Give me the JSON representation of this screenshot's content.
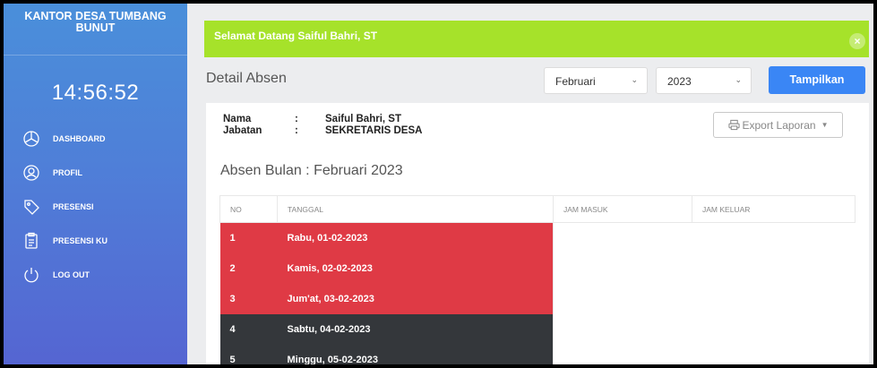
{
  "sidebar": {
    "brand": "KANTOR DESA TUMBANG BUNUT",
    "clock": "14:56:52",
    "items": [
      {
        "label": "DASHBOARD",
        "icon": "dashboard-icon"
      },
      {
        "label": "PROFIL",
        "icon": "profile-icon"
      },
      {
        "label": "PRESENSI",
        "icon": "tag-icon"
      },
      {
        "label": "PRESENSI KU",
        "icon": "clipboard-icon"
      },
      {
        "label": "LOG OUT",
        "icon": "power-icon"
      }
    ]
  },
  "alert": {
    "message": "Selamat Datang Saiful Bahri, ST",
    "close": "×"
  },
  "header": {
    "title": "Detail Absen",
    "month_value": "Februari",
    "year_value": "2023",
    "show_button": "Tampilkan"
  },
  "employee": {
    "name_label": "Nama",
    "name_value": "Saiful Bahri, ST",
    "position_label": "Jabatan",
    "position_value": "SEKRETARIS DESA",
    "separator": ":"
  },
  "export_button": "Export Laporan",
  "month_title": "Absen Bulan : Februari 2023",
  "table": {
    "headers": [
      "NO",
      "TANGGAL",
      "JAM MASUK",
      "JAM KELUAR"
    ],
    "rows": [
      {
        "no": "1",
        "date": "Rabu, 01-02-2023",
        "status": "red"
      },
      {
        "no": "2",
        "date": "Kamis, 02-02-2023",
        "status": "red"
      },
      {
        "no": "3",
        "date": "Jum'at, 03-02-2023",
        "status": "red"
      },
      {
        "no": "4",
        "date": "Sabtu, 04-02-2023",
        "status": "dark"
      },
      {
        "no": "5",
        "date": "Minggu, 05-02-2023",
        "status": "dark"
      }
    ]
  },
  "colors": {
    "alert": "#a6e22a",
    "absent_red": "#df3a45",
    "weekend_dark": "#34373b",
    "primary_button": "#3a86f5"
  }
}
